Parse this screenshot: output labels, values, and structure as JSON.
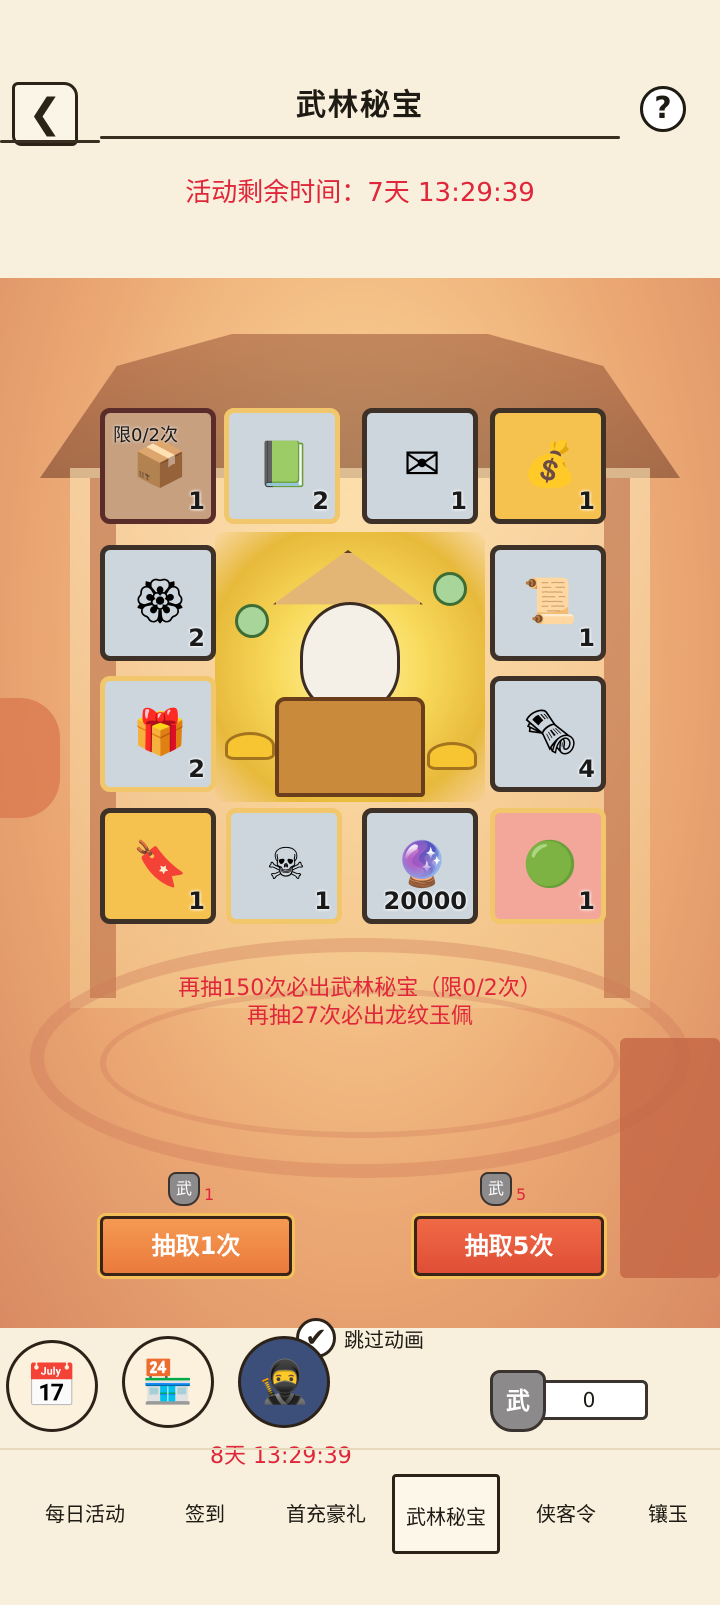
{
  "header": {
    "title": "武林秘宝",
    "back_icon": "back-chevron-icon",
    "help_label": "?",
    "timer_text": "活动剩余时间：7天 13:29:39"
  },
  "grid": {
    "items": [
      {
        "name": "treasure-chest",
        "icon": "📦",
        "limit": "限0/2次",
        "count": "1",
        "style": "dark"
      },
      {
        "name": "gold-bell-manual",
        "icon": "📗",
        "count": "2",
        "style": "gold"
      },
      {
        "name": "pearl-letter",
        "icon": "✉",
        "count": "1",
        "style": "plain"
      },
      {
        "name": "money-bag",
        "icon": "💰",
        "count": "1",
        "style": "rare"
      },
      {
        "name": "gold-token",
        "icon": "🏵",
        "count": "2",
        "style": "plain"
      },
      {
        "name": "hire-ticket",
        "icon": "📜",
        "count": "1",
        "style": "plain"
      },
      {
        "name": "red-box",
        "icon": "🎁",
        "count": "2",
        "style": "gold"
      },
      {
        "name": "silver-scroll",
        "icon": "🗞",
        "count": "4",
        "style": "plain"
      },
      {
        "name": "jade-tag",
        "icon": "🔖",
        "count": "1",
        "style": "rare"
      },
      {
        "name": "poison-flag",
        "icon": "☠",
        "count": "1",
        "style": "gold"
      },
      {
        "name": "energy-orb",
        "icon": "🔮",
        "count": "20000",
        "style": "plain"
      },
      {
        "name": "jade-pendant",
        "icon": "🟢",
        "count": "1",
        "style": "red"
      }
    ]
  },
  "hints": {
    "line1": "再抽150次必出武林秘宝（限0/2次）",
    "line2": "再抽27次必出龙纹玉佩"
  },
  "draw": {
    "one": {
      "cost_badge": "武",
      "cost": "1",
      "label": "抽取1次"
    },
    "five": {
      "cost_badge": "武",
      "cost": "5",
      "label": "抽取5次"
    }
  },
  "skip": {
    "check": "✔",
    "label": "跳过动画"
  },
  "bottom": {
    "countdown": "8天 13:29:39",
    "currency_badge": "武",
    "currency_value": "0",
    "icons": [
      "calendar-icon",
      "shop-icon",
      "hero-portrait-icon"
    ]
  },
  "tabs": [
    {
      "label": "每日活动",
      "active": false
    },
    {
      "label": "签到",
      "active": false
    },
    {
      "label": "首充豪礼",
      "active": false
    },
    {
      "label": "武林秘宝",
      "active": true
    },
    {
      "label": "侠客令",
      "active": false
    },
    {
      "label": "镶玉",
      "active": false
    }
  ]
}
